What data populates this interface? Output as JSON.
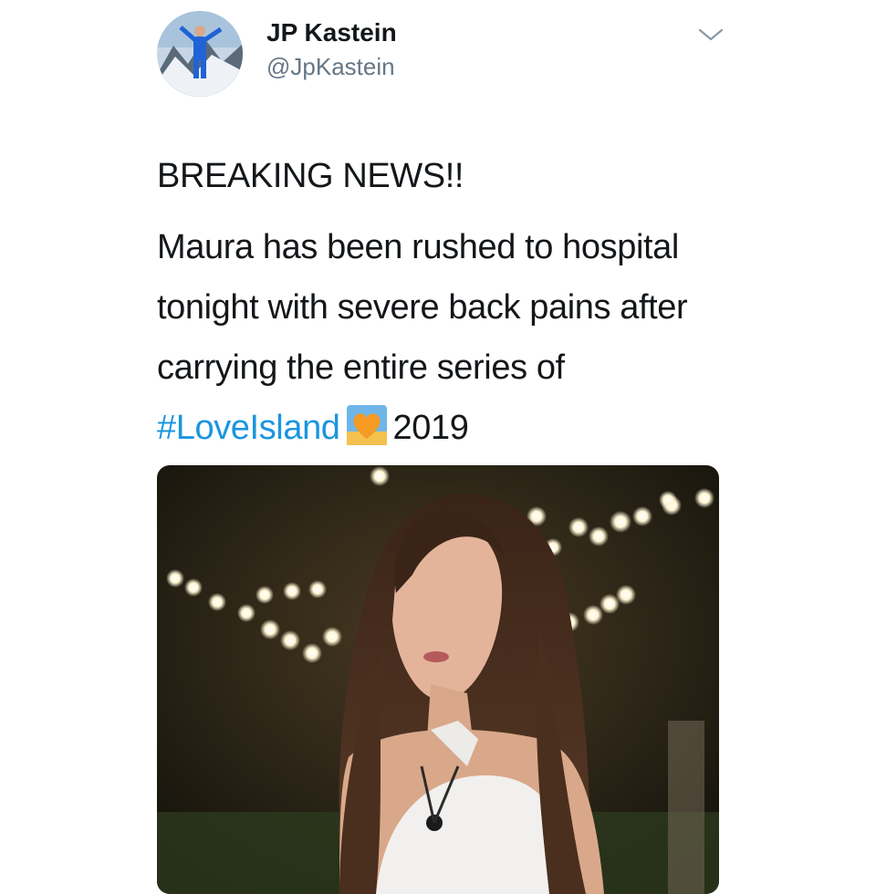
{
  "tweet": {
    "author": {
      "display_name": "JP Kastein",
      "handle": "@JpKastein"
    },
    "menu_icon": "chevron-down-icon",
    "headline": "BREAKING NEWS!!",
    "body_before": "Maura has been rushed to hospital tonight with severe back pains after carrying the entire series of ",
    "hashtag": "#LoveIsland",
    "emoji": "orange-heart-emoji",
    "body_after": "2019",
    "colors": {
      "link": "#1b95e0",
      "text": "#14171a",
      "secondary": "#657786"
    }
  }
}
